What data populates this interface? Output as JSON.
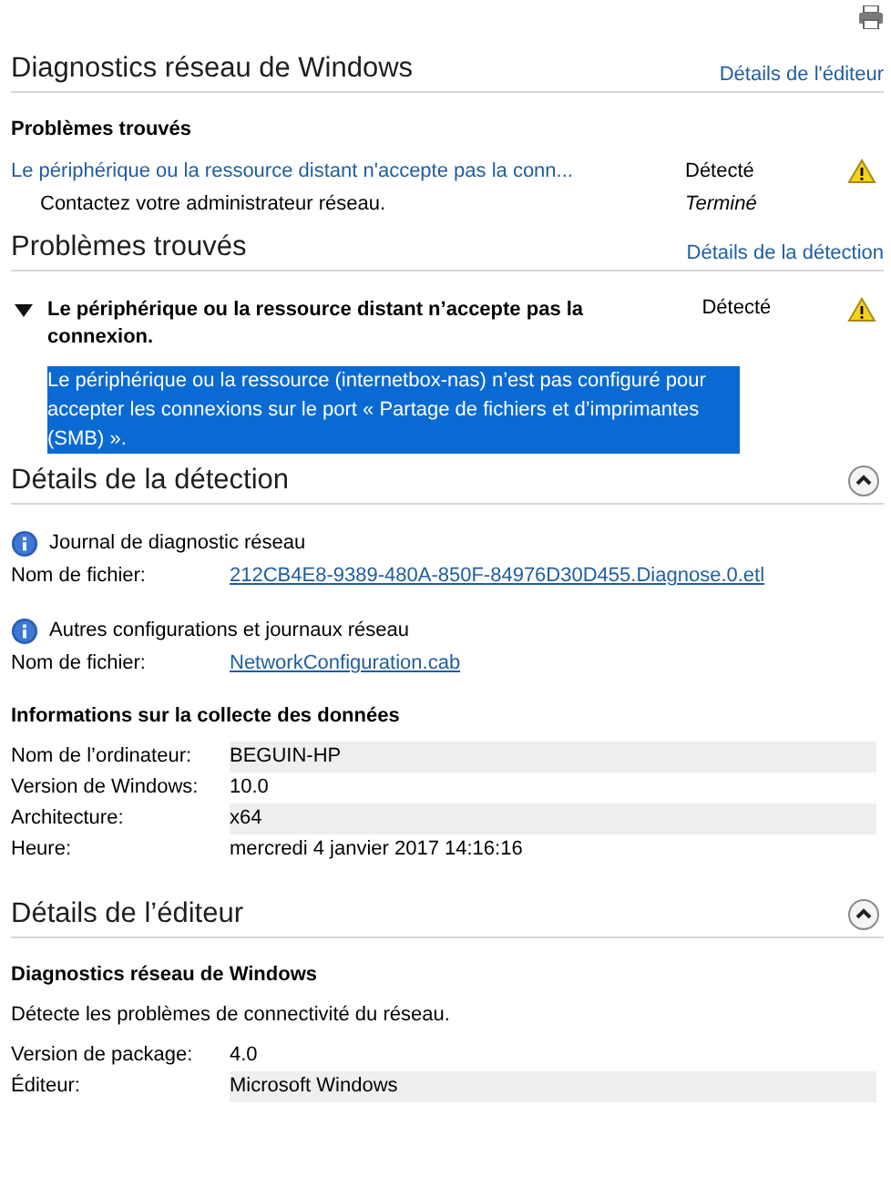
{
  "summary": {
    "title": "Diagnostics réseau de Windows",
    "link": "Détails de l'éditeur",
    "heading": "Problèmes trouvés",
    "rows": [
      {
        "kind": "problem",
        "text": "Le périphérique ou la ressource distant n'accepte pas la conn...",
        "status": "Détecté"
      },
      {
        "kind": "action",
        "text": "Contactez votre administrateur réseau.",
        "status": "Terminé"
      }
    ]
  },
  "problems_found": {
    "title": "Problèmes trouvés",
    "link": "Détails de la détection",
    "issue": {
      "title": "Le périphérique ou la ressource distant n’accepte pas la connexion.",
      "status": "Détecté",
      "expanded": true,
      "description": "Le périphérique ou la ressource (internetbox-nas) n’est pas configuré pour accepter les connexions sur le port « Partage de fichiers et d’imprimantes (SMB) ».",
      "selected": true
    }
  },
  "detection_details": {
    "title": "Détails de la détection",
    "expanded": true,
    "files": [
      {
        "title": "Journal de diagnostic réseau",
        "label": "Nom de fichier:",
        "file": "212CB4E8-9389-480A-850F-84976D30D455.Diagnose.0.etl"
      },
      {
        "title": "Autres configurations et journaux réseau",
        "label": "Nom de fichier:",
        "file": "NetworkConfiguration.cab"
      }
    ],
    "info_heading": "Informations sur la collecte des données",
    "info": [
      {
        "label": "Nom de l’ordinateur:",
        "value": "BEGUIN-HP"
      },
      {
        "label": "Version de Windows:",
        "value": "10.0"
      },
      {
        "label": "Architecture:",
        "value": "x64"
      },
      {
        "label": "Heure:",
        "value": "mercredi 4 janvier 2017 14:16:16"
      }
    ]
  },
  "publisher_details": {
    "title": "Détails de l’éditeur",
    "expanded": true,
    "name": "Diagnostics réseau de Windows",
    "description": "Détecte les problèmes de connectivité du réseau.",
    "info": [
      {
        "label": "Version de package:",
        "value": "4.0"
      },
      {
        "label": "Éditeur:",
        "value": "Microsoft Windows"
      }
    ]
  }
}
